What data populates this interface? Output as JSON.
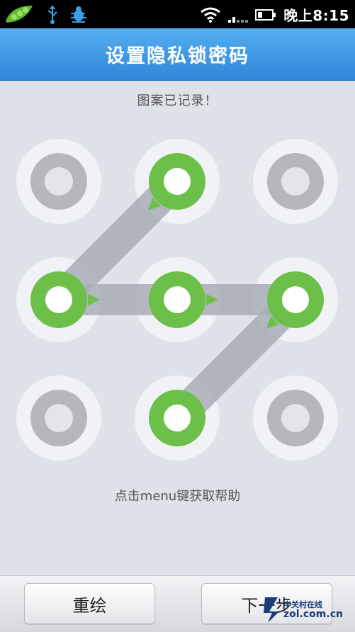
{
  "status_bar": {
    "time": "晚上8:15",
    "icons": [
      "pea-pod-app-icon",
      "usb-icon",
      "debug-bug-icon",
      "wifi-icon",
      "signal-icon",
      "battery-icon"
    ]
  },
  "header": {
    "title": "设置隐私锁密码"
  },
  "pattern": {
    "status_message": "图案已记录！",
    "grid_size": 3,
    "dots": [
      {
        "row": 0,
        "col": 0,
        "selected": false
      },
      {
        "row": 0,
        "col": 1,
        "selected": true
      },
      {
        "row": 0,
        "col": 2,
        "selected": false
      },
      {
        "row": 1,
        "col": 0,
        "selected": true
      },
      {
        "row": 1,
        "col": 1,
        "selected": true
      },
      {
        "row": 1,
        "col": 2,
        "selected": true
      },
      {
        "row": 2,
        "col": 0,
        "selected": false
      },
      {
        "row": 2,
        "col": 1,
        "selected": true
      },
      {
        "row": 2,
        "col": 2,
        "selected": false
      }
    ],
    "path_sequence": [
      [
        0,
        1
      ],
      [
        1,
        0
      ],
      [
        1,
        1
      ],
      [
        1,
        2
      ],
      [
        2,
        1
      ]
    ],
    "colors": {
      "selected": "#6cc04a",
      "unselected_ring": "#b5b7bc",
      "outer_disc": "#f1f2f5",
      "inner_unselected": "#e4e5e8",
      "path": "#a9adb6"
    },
    "hint": "点击menu键获取帮助"
  },
  "footer": {
    "redraw_label": "重绘",
    "next_label": "下一步"
  },
  "watermark": {
    "top_text": "中关村在线",
    "bottom_text": "zol.com.cn"
  }
}
